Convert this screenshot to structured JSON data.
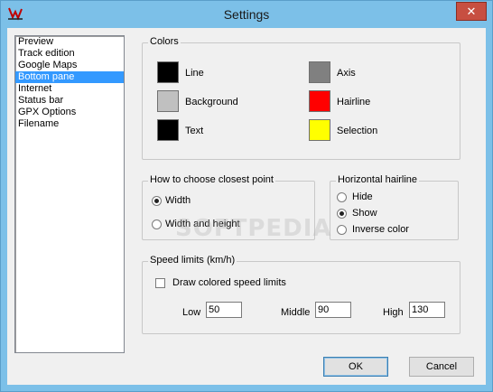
{
  "window": {
    "title": "Settings",
    "close_glyph": "✕"
  },
  "sidebar": {
    "items": [
      {
        "label": "Preview",
        "selected": false
      },
      {
        "label": "Track edition",
        "selected": false
      },
      {
        "label": "Google Maps",
        "selected": false
      },
      {
        "label": "Bottom pane",
        "selected": true
      },
      {
        "label": "Internet",
        "selected": false
      },
      {
        "label": "Status bar",
        "selected": false
      },
      {
        "label": "GPX Options",
        "selected": false
      },
      {
        "label": "Filename",
        "selected": false
      }
    ]
  },
  "colors": {
    "legend": "Colors",
    "line": {
      "label": "Line",
      "color": "#000000"
    },
    "background": {
      "label": "Background",
      "color": "#c0c0c0"
    },
    "text": {
      "label": "Text",
      "color": "#000000"
    },
    "axis": {
      "label": "Axis",
      "color": "#808080"
    },
    "hairline": {
      "label": "Hairline",
      "color": "#ff0000"
    },
    "selection": {
      "label": "Selection",
      "color": "#ffff00"
    }
  },
  "closest_point": {
    "legend": "How to choose closest point",
    "options": [
      {
        "label": "Width",
        "checked": true
      },
      {
        "label": "Width and height",
        "checked": false
      }
    ]
  },
  "hairline": {
    "legend": "Horizontal hairline",
    "options": [
      {
        "label": "Hide",
        "checked": false
      },
      {
        "label": "Show",
        "checked": true
      },
      {
        "label": "Inverse color",
        "checked": false
      }
    ]
  },
  "speed_limits": {
    "legend": "Speed limits (km/h)",
    "draw_label": "Draw colored speed limits",
    "draw_checked": false,
    "low_label": "Low",
    "low_value": "50",
    "middle_label": "Middle",
    "middle_value": "90",
    "high_label": "High",
    "high_value": "130"
  },
  "buttons": {
    "ok": "OK",
    "cancel": "Cancel"
  },
  "watermark": "SOFTPEDIA"
}
